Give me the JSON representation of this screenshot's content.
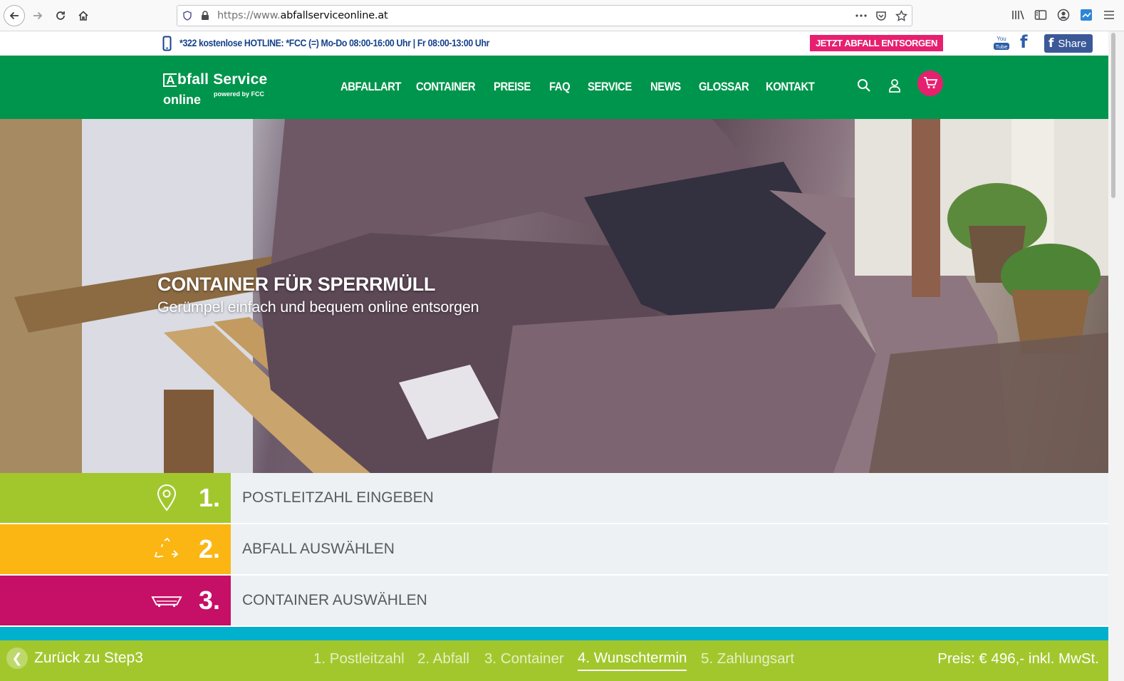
{
  "browser": {
    "url_prefix": "https://www.",
    "url_host": "abfallserviceonline.at",
    "url_actions": [
      "more-icon",
      "pocket-icon",
      "bookmark-star-icon"
    ],
    "toolbar": [
      "library-icon",
      "sidebar-icon",
      "account-icon",
      "extension-icon",
      "menu-icon"
    ]
  },
  "info_bar": {
    "hotline": "*322  kostenlose HOTLINE: *FCC (=)   Mo-Do 08:00-16:00 Uhr | Fr 08:00-13:00 Uhr",
    "cta": "JETZT ABFALL ENTSORGEN",
    "youtube_top": "You",
    "youtube_bottom": "Tube",
    "facebook_glyph": "f",
    "share": "Share"
  },
  "nav": {
    "logo_a": "A",
    "logo_main": "bfall Service",
    "logo_sub": "online",
    "logo_powered": "powered by FCC",
    "items": [
      "ABFALLART",
      "CONTAINER",
      "PREISE",
      "FAQ",
      "SERVICE",
      "NEWS",
      "GLOSSAR",
      "KONTAKT"
    ]
  },
  "hero": {
    "title": "CONTAINER FÜR SPERRMÜLL",
    "subtitle": "Gerümpel einfach und bequem online entsorgen"
  },
  "steps": [
    {
      "number": "1.",
      "label": "POSTLEITZAHL EINGEBEN",
      "color": "#a2c72d",
      "icon": "location-pin-icon"
    },
    {
      "number": "2.",
      "label": "ABFALL AUSWÄHLEN",
      "color": "#fbb614",
      "icon": "recycle-icon"
    },
    {
      "number": "3.",
      "label": "CONTAINER AUSWÄHLEN",
      "color": "#c60f67",
      "icon": "container-icon"
    },
    {
      "color": "#00b0cc"
    }
  ],
  "footer": {
    "back": "Zurück zu Step3",
    "back_icon": "❮",
    "progress": [
      "1. Postleitzahl",
      "2. Abfall",
      "3. Container",
      "4. Wunschtermin",
      "5. Zahlungsart"
    ],
    "active_step": 4,
    "price": "Preis: € 496,- inkl. MwSt."
  },
  "colors": {
    "brand_green": "#00954c",
    "accent_pink": "#e6206f",
    "footer_green": "#a2c72d",
    "hotline_blue": "#14418b"
  }
}
